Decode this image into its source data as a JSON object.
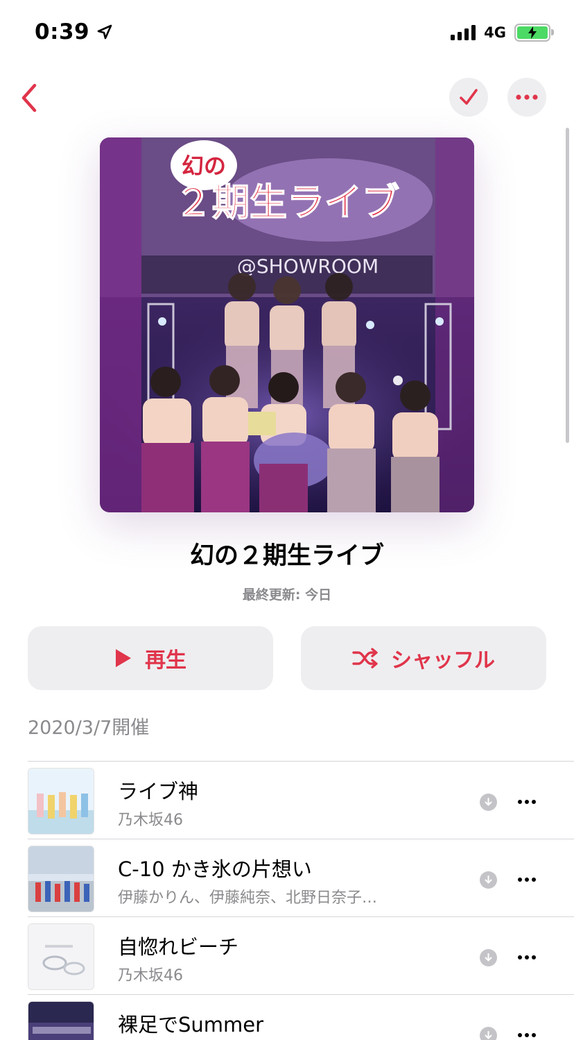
{
  "status_bar": {
    "time": "0:39",
    "network": "4G",
    "location_icon": "location-arrow-icon",
    "signal_icon": "cellular-signal-icon",
    "battery_icon": "battery-charging-icon"
  },
  "nav": {
    "back_icon": "chevron-left-icon",
    "check_icon": "checkmark-icon",
    "more_icon": "ellipsis-icon"
  },
  "playlist": {
    "title": "幻の２期生ライブ",
    "subtitle": "最終更新: 今日",
    "description": "2020/3/7開催",
    "artwork_text": {
      "logo_top": "幻の",
      "banner": "２期生ライブ",
      "showroom": "@SHOWROOM"
    }
  },
  "actions": {
    "play_label": "再生",
    "shuffle_label": "シャッフル",
    "play_icon": "play-icon",
    "shuffle_icon": "shuffle-icon"
  },
  "tracks": [
    {
      "title": "ライブ神",
      "artist": "乃木坂46"
    },
    {
      "title": "C-10 かき氷の片想い",
      "artist": "伊藤かりん、伊藤純奈、北野日奈子…"
    },
    {
      "title": "自惚れビーチ",
      "artist": "乃木坂46"
    },
    {
      "title": "裸足でSummer",
      "artist": ""
    }
  ],
  "colors": {
    "accent": "#e0354b",
    "secondary_text": "#8a8a8e",
    "button_bg": "#eeeef0"
  }
}
